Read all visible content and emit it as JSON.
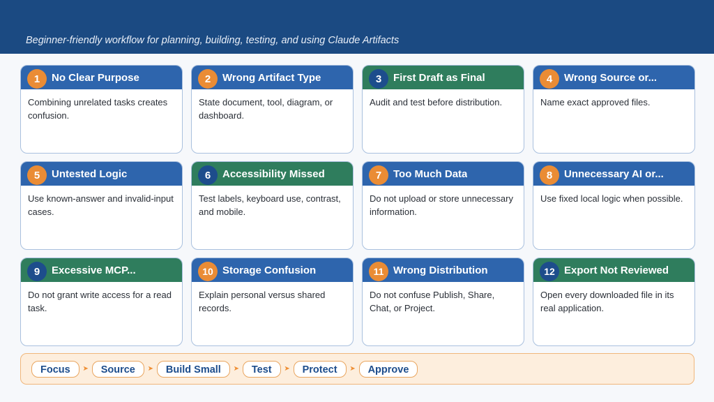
{
  "header": {
    "subtitle": "Beginner-friendly workflow for planning, building, testing, and using Claude Artifacts",
    "background_color": "#1b4a82"
  },
  "cards": [
    {
      "number": "1",
      "title": "No Clear Purpose",
      "body": "Combining unrelated tasks creates confusion.",
      "header_color": "blue",
      "badge_color": "orange"
    },
    {
      "number": "2",
      "title": "Wrong Artifact Type",
      "body": "State document, tool, diagram, or dashboard.",
      "header_color": "blue",
      "badge_color": "orange"
    },
    {
      "number": "3",
      "title": "First Draft as Final",
      "body": "Audit and test before distribution.",
      "header_color": "green",
      "badge_color": "navy"
    },
    {
      "number": "4",
      "title": "Wrong Source or...",
      "body": "Name exact approved files.",
      "header_color": "blue",
      "badge_color": "orange"
    },
    {
      "number": "5",
      "title": "Untested Logic",
      "body": "Use known-answer and invalid-input cases.",
      "header_color": "blue",
      "badge_color": "orange"
    },
    {
      "number": "6",
      "title": "Accessibility Missed",
      "body": "Test labels, keyboard use, contrast, and mobile.",
      "header_color": "green",
      "badge_color": "navy"
    },
    {
      "number": "7",
      "title": "Too Much Data",
      "body": "Do not upload or store unnecessary information.",
      "header_color": "blue",
      "badge_color": "orange"
    },
    {
      "number": "8",
      "title": "Unnecessary AI or...",
      "body": "Use fixed local logic when possible.",
      "header_color": "blue",
      "badge_color": "orange"
    },
    {
      "number": "9",
      "title": "Excessive MCP...",
      "body": "Do not grant write access for a read task.",
      "header_color": "green",
      "badge_color": "navy"
    },
    {
      "number": "10",
      "title": "Storage Confusion",
      "body": "Explain personal versus shared records.",
      "header_color": "blue",
      "badge_color": "orange"
    },
    {
      "number": "11",
      "title": "Wrong Distribution",
      "body": "Do not confuse Publish, Share, Chat, or Project.",
      "header_color": "blue",
      "badge_color": "orange"
    },
    {
      "number": "12",
      "title": "Export Not Reviewed",
      "body": "Open every downloaded file in its real application.",
      "header_color": "green",
      "badge_color": "navy"
    }
  ],
  "flow": {
    "steps": [
      "Focus",
      "Source",
      "Build Small",
      "Test",
      "Protect",
      "Approve"
    ],
    "arrow_icon": "arrow-right-icon"
  },
  "colors": {
    "blue_header": "#2e65ad",
    "green_header": "#2f7d5d",
    "orange_badge": "#ea8c35",
    "navy_badge": "#1d4d8c",
    "flow_background": "#fdeedd"
  }
}
